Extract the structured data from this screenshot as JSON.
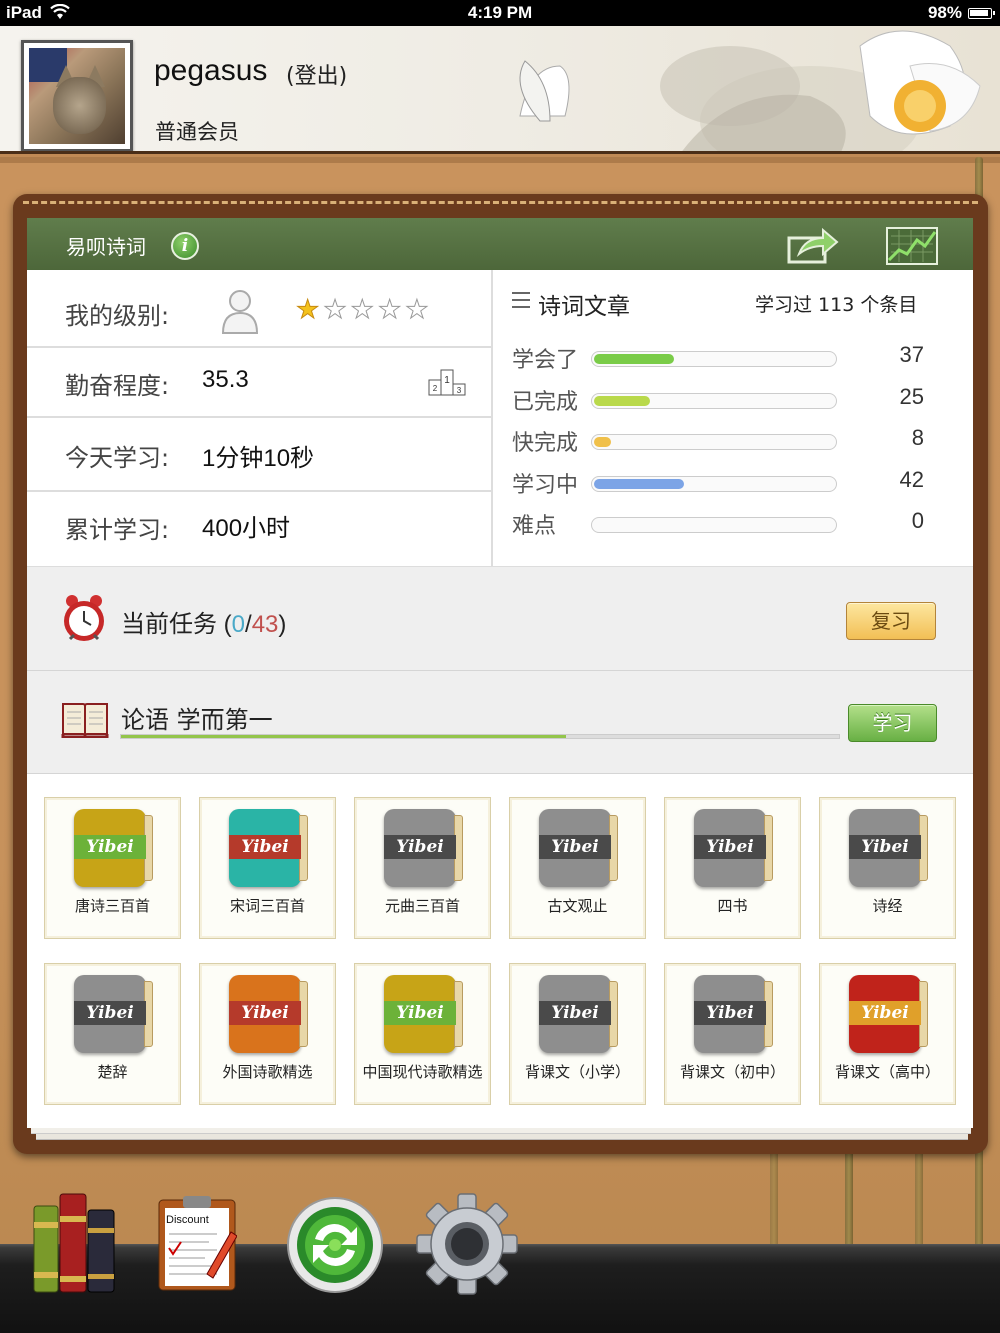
{
  "status_bar": {
    "device": "iPad",
    "time": "4:19 PM",
    "battery": "98%"
  },
  "profile": {
    "username": "pegasus",
    "logout_label": "(登出)",
    "membership": "普通会员"
  },
  "app": {
    "title": "易呗诗词"
  },
  "stats": {
    "level_label": "我的级别:",
    "level_stars": 1,
    "level_stars_max": 5,
    "diligence_label": "勤奋程度:",
    "diligence_value": "35.3",
    "today_label": "今天学习:",
    "today_value": "1分钟10秒",
    "total_label": "累计学习:",
    "total_value": "400小时"
  },
  "poems": {
    "title": "诗词文章",
    "count_text": "学习过 113 个条目",
    "progress": [
      {
        "label": "学会了",
        "value": "37",
        "fraction": 0.33,
        "color": "#7acc48"
      },
      {
        "label": "已完成",
        "value": "25",
        "fraction": 0.23,
        "color": "#b9d94b"
      },
      {
        "label": "快完成",
        "value": "8",
        "fraction": 0.07,
        "color": "#f0c04a"
      },
      {
        "label": "学习中",
        "value": "42",
        "fraction": 0.37,
        "color": "#7ca4e6"
      },
      {
        "label": "难点",
        "value": "0",
        "fraction": 0,
        "color": "#cccccc"
      }
    ]
  },
  "task": {
    "label": "当前任务",
    "paren_open": " (",
    "done": "0",
    "sep": "/",
    "total": "43",
    "paren_close": ")",
    "review_button": "复习"
  },
  "course": {
    "name": "论语  学而第一",
    "progress_fraction": 0.62,
    "study_button": "学习"
  },
  "books": [
    {
      "label": "唐诗三百首",
      "cover": "#c7a417",
      "band": "#6cb239"
    },
    {
      "label": "宋词三百首",
      "cover": "#2ab4a6",
      "band": "#b53a2b"
    },
    {
      "label": "元曲三百首",
      "cover": "#8e8e8e",
      "band": "#4a4a4a"
    },
    {
      "label": "古文观止",
      "cover": "#8e8e8e",
      "band": "#4a4a4a"
    },
    {
      "label": "四书",
      "cover": "#8e8e8e",
      "band": "#4a4a4a"
    },
    {
      "label": "诗经",
      "cover": "#8e8e8e",
      "band": "#4a4a4a"
    },
    {
      "label": "楚辞",
      "cover": "#8e8e8e",
      "band": "#4a4a4a"
    },
    {
      "label": "外国诗歌精选",
      "cover": "#d9731c",
      "band": "#b53a2b"
    },
    {
      "label": "中国现代诗歌精选",
      "cover": "#c7a417",
      "band": "#6cb239"
    },
    {
      "label": "背课文（小学）",
      "cover": "#8e8e8e",
      "band": "#4a4a4a"
    },
    {
      "label": "背课文（初中）",
      "cover": "#8e8e8e",
      "band": "#4a4a4a"
    },
    {
      "label": "背课文（高中）",
      "cover": "#c0231b",
      "band": "#e0a02a"
    }
  ],
  "book_brand": "Yibei",
  "dock": {
    "items": [
      "library-icon",
      "discount-clipboard-icon",
      "sync-icon",
      "settings-gear-icon"
    ],
    "clipboard_title": "Discount"
  }
}
